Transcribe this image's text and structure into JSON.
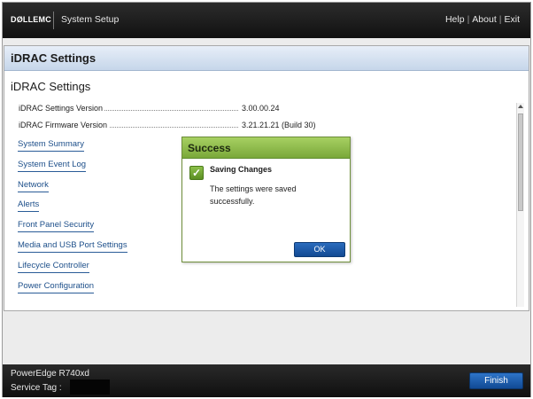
{
  "header": {
    "logo": "DØLLEMC",
    "app_title": "System Setup",
    "links": [
      "Help",
      "About",
      "Exit"
    ],
    "separator": "|"
  },
  "panel": {
    "title": "iDRAC Settings",
    "section_title": "iDRAC Settings",
    "info": [
      {
        "label": "iDRAC Settings Version",
        "value": "3.00.00.24"
      },
      {
        "label": "iDRAC Firmware Version",
        "value": "3.21.21.21 (Build 30)"
      }
    ],
    "links": [
      "System Summary",
      "System Event Log",
      "Network",
      "Alerts",
      "Front Panel Security",
      "Media and USB Port Settings",
      "Lifecycle Controller",
      "Power Configuration"
    ]
  },
  "dialog": {
    "title": "Success",
    "icon": "check-icon",
    "heading": "Saving Changes",
    "message": "The settings were saved successfully.",
    "ok_label": "OK"
  },
  "footer": {
    "model": "PowerEdge R740xd",
    "service_tag_label": "Service Tag :",
    "finish_label": "Finish"
  },
  "colors": {
    "header_bg": "#1a1a1a",
    "panel_header": "#c6d6ea",
    "link": "#1d4f8a",
    "success_green": "#7aa83a",
    "button_blue": "#1b5aa8"
  }
}
